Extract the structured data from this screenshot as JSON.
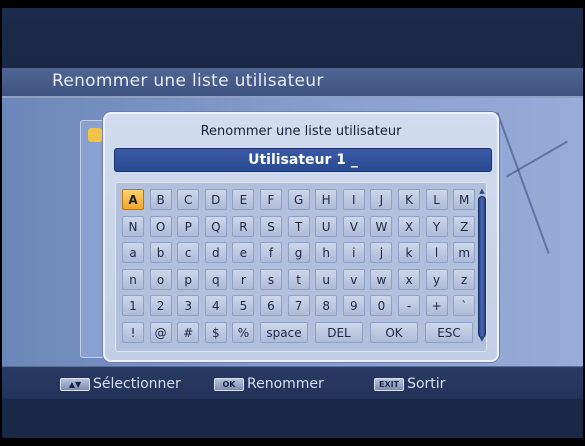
{
  "header": {
    "title": "Renommer une liste utilisateur"
  },
  "dialog": {
    "title": "Renommer une liste utilisateur",
    "name_value": "Utilisateur 1",
    "cursor": "_",
    "keyboard_rows": [
      [
        "A",
        "B",
        "C",
        "D",
        "E",
        "F",
        "G",
        "H",
        "I",
        "J",
        "K",
        "L",
        "M"
      ],
      [
        "N",
        "O",
        "P",
        "Q",
        "R",
        "S",
        "T",
        "U",
        "V",
        "W",
        "X",
        "Y",
        "Z"
      ],
      [
        "a",
        "b",
        "c",
        "d",
        "e",
        "f",
        "g",
        "h",
        "i",
        "j",
        "k",
        "l",
        "m"
      ],
      [
        "n",
        "o",
        "p",
        "q",
        "r",
        "s",
        "t",
        "u",
        "v",
        "w",
        "x",
        "y",
        "z"
      ],
      [
        "1",
        "2",
        "3",
        "4",
        "5",
        "6",
        "7",
        "8",
        "9",
        "0",
        "-",
        "+",
        "`"
      ],
      [
        "!",
        "@",
        "#",
        "$",
        "%",
        "space",
        "DEL",
        "OK",
        "ESC"
      ]
    ],
    "selected_key": "A"
  },
  "footer": [
    {
      "key": "▲▼",
      "label": "Sélectionner"
    },
    {
      "key": "OK",
      "label": "Renommer"
    },
    {
      "key": "EXIT",
      "label": "Sortir"
    }
  ],
  "colors": {
    "selected_key": "#f2a72d",
    "name_field": "#2a4a92"
  }
}
